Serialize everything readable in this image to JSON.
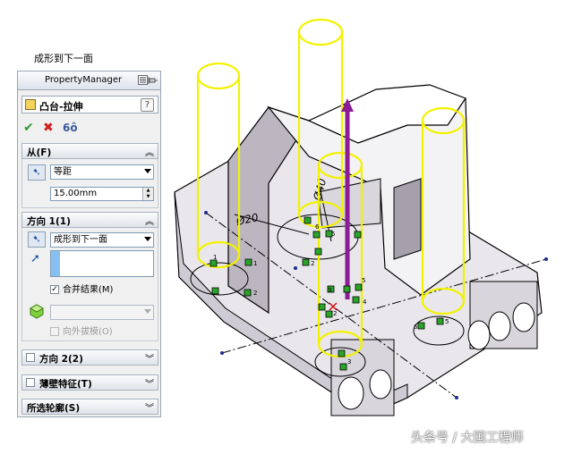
{
  "caption": "成形到下一面",
  "property_manager": {
    "title": "PropertyManager",
    "header_icons": [
      "collapse-icon",
      "pin-icon"
    ],
    "feature_title": "凸台-拉伸",
    "help_label": "?",
    "actions": {
      "ok": "✔",
      "cancel": "✖",
      "preview": "6ô"
    },
    "from": {
      "header": "从(F)",
      "start_condition": "等距",
      "offset_value": "15.00mm"
    },
    "direction1": {
      "header": "方向 1(1)",
      "end_condition": "成形到下一面",
      "merge_result_label": "合并结果(M)",
      "merge_result_checked": true,
      "draft_label": "向外拔模(O)",
      "draft_checked": false
    },
    "collapsed_groups": [
      {
        "label": "方向 2(2)",
        "checked": false
      },
      {
        "label": "薄壁特征(T)",
        "checked": false
      },
      {
        "label": "所选轮廓(S)"
      }
    ]
  },
  "viewport": {
    "dimension_labels": [
      "Ø20",
      "Ø40"
    ],
    "point_labels": [
      "1",
      "2",
      "3",
      "4",
      "5",
      "6"
    ],
    "watermark": "头条号 / 大国工程师"
  }
}
